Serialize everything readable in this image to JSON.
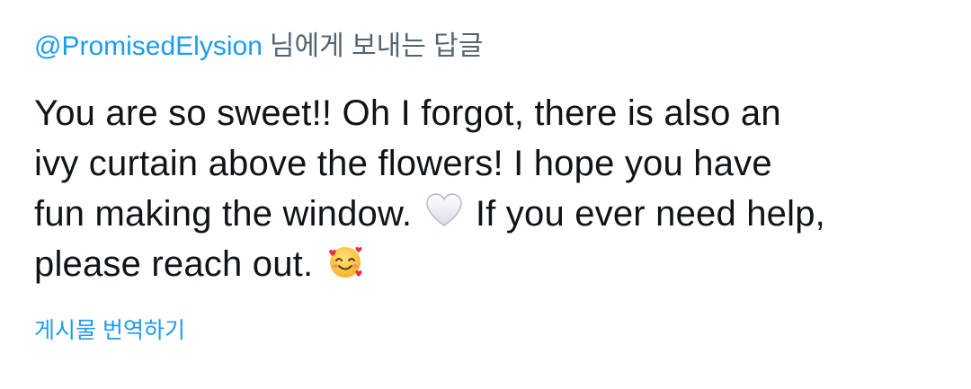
{
  "reply_context": {
    "mention": "@PromisedElysion",
    "suffix": "님에게 보내는 답글"
  },
  "tweet": {
    "line1": "You are so sweet!! Oh I forgot, there is also an",
    "line2": "ivy curtain above the flowers! I hope you have",
    "line3_before": "fun making the window.",
    "line3_after": "If you ever need help,",
    "line4": "please reach out.",
    "emoji_1": "white-heart-emoji",
    "emoji_2": "smiling-face-with-hearts-emoji"
  },
  "translate": {
    "label": "게시물 번역하기"
  },
  "colors": {
    "accent": "#1d9bf0",
    "text": "#0f1419",
    "muted": "#536471"
  }
}
